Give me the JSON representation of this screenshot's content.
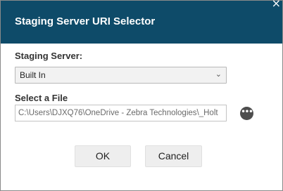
{
  "dialog": {
    "title": "Staging Server URI Selector",
    "close_glyph": "×"
  },
  "staging_server": {
    "label": "Staging Server:",
    "selected": "Built In",
    "chevron": "⌄"
  },
  "file": {
    "label": "Select a File",
    "value": "C:\\Users\\DJXQ76\\OneDrive - Zebra Technologies\\_Holt",
    "more_glyph": "•••"
  },
  "buttons": {
    "ok": "OK",
    "cancel": "Cancel"
  },
  "colors": {
    "titlebar": "#0e4b69",
    "button_bg": "#eeeeee"
  }
}
